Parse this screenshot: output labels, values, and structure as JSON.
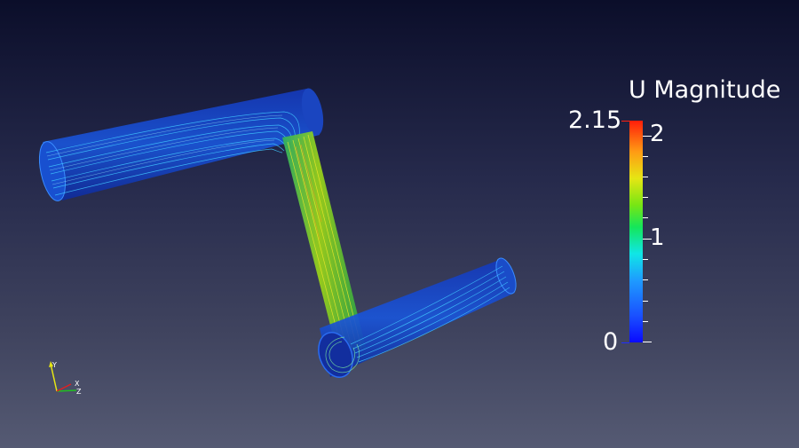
{
  "legend": {
    "title": "U Magnitude",
    "range_max_label": "2.15",
    "range_min_label": "0",
    "tick_labels": [
      "2",
      "1"
    ],
    "colors": {
      "low": "#0a0aff",
      "mid": "#14e65a",
      "high": "#ff1e0a"
    }
  },
  "orientation_axes": {
    "y_label": "Y",
    "x_label": "X",
    "z_label": "Z"
  }
}
